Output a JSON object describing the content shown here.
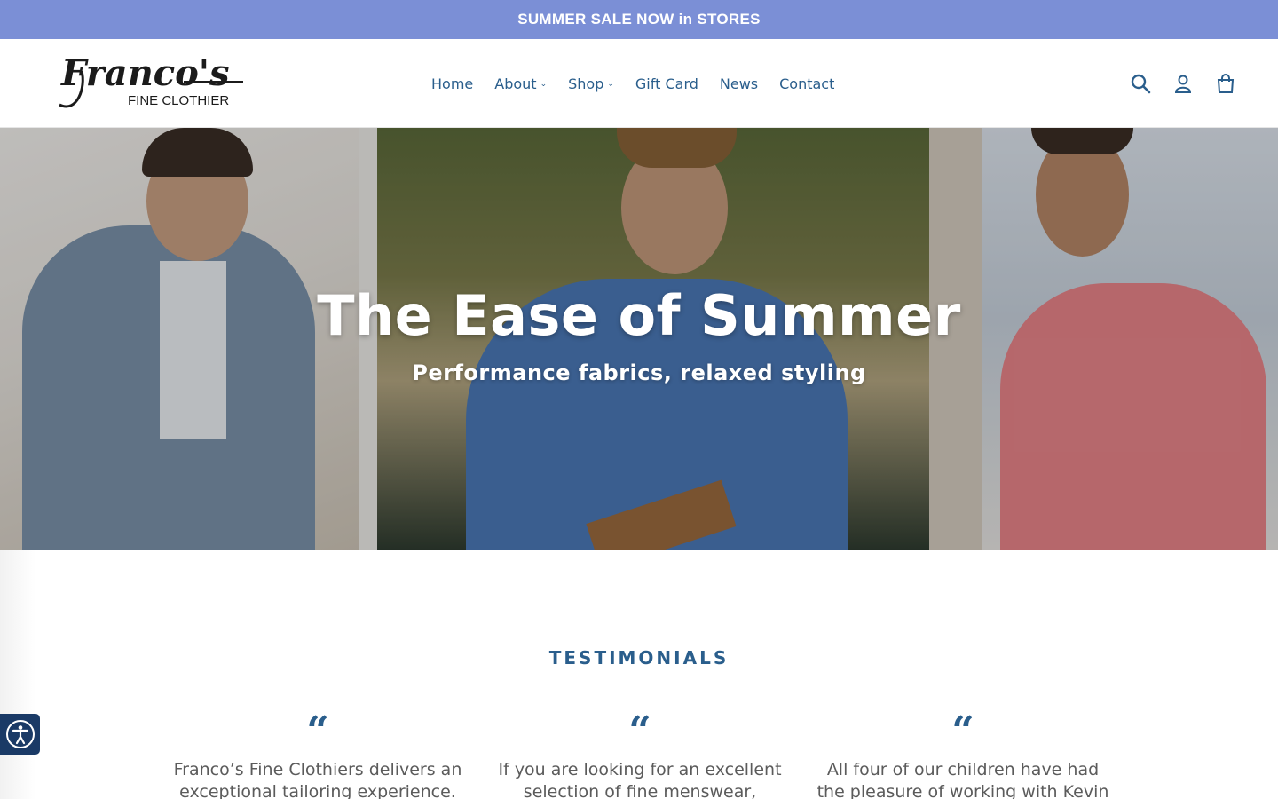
{
  "announcement": {
    "text": "SUMMER SALE NOW in STORES"
  },
  "brand": {
    "logo_main": "Franco's",
    "logo_sub": "FINE CLOTHIER"
  },
  "nav": {
    "items": [
      {
        "label": "Home",
        "dropdown": false
      },
      {
        "label": "About",
        "dropdown": true
      },
      {
        "label": "Shop",
        "dropdown": true
      },
      {
        "label": "Gift Card",
        "dropdown": false
      },
      {
        "label": "News",
        "dropdown": false
      },
      {
        "label": "Contact",
        "dropdown": false
      }
    ]
  },
  "header_icons": [
    "search-icon",
    "user-icon",
    "cart-icon"
  ],
  "hero": {
    "title": "The Ease of Summer",
    "subtitle": "Performance fabrics, relaxed styling"
  },
  "testimonials": {
    "heading": "TESTIMONIALS",
    "quote_mark": "“",
    "items": [
      {
        "text": "Franco’s Fine Clothiers delivers an exceptional tailoring experience. The"
      },
      {
        "text": "If you are looking for an excellent selection of fine menswear, excellent"
      },
      {
        "text": "All four of our children have had the pleasure of working with Kevin and"
      }
    ]
  },
  "colors": {
    "announcement_bg": "#7b8fd6",
    "brand_blue": "#2a5e8c",
    "accessibility_bg": "#1a3a66"
  }
}
